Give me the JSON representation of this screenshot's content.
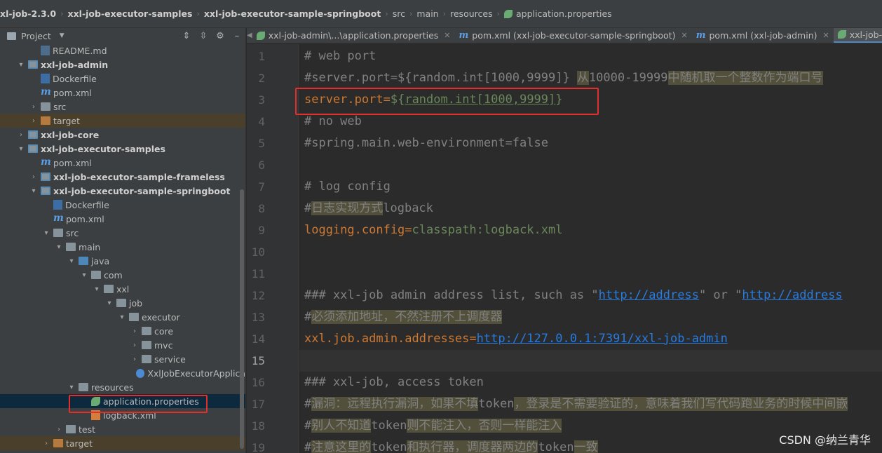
{
  "breadcrumb": [
    "xl-job-2.3.0",
    "xxl-job-executor-samples",
    "xxl-job-executor-sample-springboot",
    "src",
    "main",
    "resources",
    "application.properties"
  ],
  "project_panel": {
    "title": "Project",
    "tree": [
      {
        "label": "README.md",
        "icon": "markdown-file-icon",
        "indent": 2,
        "arrow": ""
      },
      {
        "label": "xxl-job-admin",
        "icon": "module-folder-icon",
        "indent": 1,
        "arrow": "▾",
        "bold": true
      },
      {
        "label": "Dockerfile",
        "icon": "docker-file-icon",
        "indent": 2,
        "arrow": ""
      },
      {
        "label": "pom.xml",
        "icon": "maven-file-icon",
        "indent": 2,
        "arrow": ""
      },
      {
        "label": "src",
        "icon": "folder-icon",
        "indent": 2,
        "arrow": "›"
      },
      {
        "label": "target",
        "icon": "folder-orange-icon",
        "indent": 2,
        "arrow": "›",
        "highlight": true
      },
      {
        "label": "xxl-job-core",
        "icon": "module-folder-icon",
        "indent": 1,
        "arrow": "›",
        "bold": true
      },
      {
        "label": "xxl-job-executor-samples",
        "icon": "module-folder-icon",
        "indent": 1,
        "arrow": "▾",
        "bold": true
      },
      {
        "label": "pom.xml",
        "icon": "maven-file-icon",
        "indent": 2,
        "arrow": ""
      },
      {
        "label": "xxl-job-executor-sample-frameless",
        "icon": "module-folder-icon",
        "indent": 2,
        "arrow": "›",
        "bold": true
      },
      {
        "label": "xxl-job-executor-sample-springboot",
        "icon": "module-folder-icon",
        "indent": 2,
        "arrow": "▾",
        "bold": true
      },
      {
        "label": "Dockerfile",
        "icon": "docker-file-icon",
        "indent": 3,
        "arrow": ""
      },
      {
        "label": "pom.xml",
        "icon": "maven-file-icon",
        "indent": 3,
        "arrow": ""
      },
      {
        "label": "src",
        "icon": "folder-icon",
        "indent": 3,
        "arrow": "▾"
      },
      {
        "label": "main",
        "icon": "folder-icon",
        "indent": 4,
        "arrow": "▾"
      },
      {
        "label": "java",
        "icon": "folder-blue-icon",
        "indent": 5,
        "arrow": "▾"
      },
      {
        "label": "com",
        "icon": "package-icon",
        "indent": 6,
        "arrow": "▾"
      },
      {
        "label": "xxl",
        "icon": "package-icon",
        "indent": 7,
        "arrow": "▾"
      },
      {
        "label": "job",
        "icon": "package-icon",
        "indent": 8,
        "arrow": "▾"
      },
      {
        "label": "executor",
        "icon": "package-icon",
        "indent": 9,
        "arrow": "▾"
      },
      {
        "label": "core",
        "icon": "package-icon",
        "indent": 10,
        "arrow": "›"
      },
      {
        "label": "mvc",
        "icon": "package-icon",
        "indent": 10,
        "arrow": "›"
      },
      {
        "label": "service",
        "icon": "package-icon",
        "indent": 10,
        "arrow": "›"
      },
      {
        "label": "XxlJobExecutorApplica",
        "icon": "spring-class-icon",
        "indent": 10,
        "arrow": ""
      },
      {
        "label": "resources",
        "icon": "resources-folder-icon",
        "indent": 5,
        "arrow": "▾"
      },
      {
        "label": "application.properties",
        "icon": "properties-file-icon",
        "indent": 6,
        "arrow": "",
        "selected": true
      },
      {
        "label": "logback.xml",
        "icon": "xml-file-icon",
        "indent": 6,
        "arrow": ""
      },
      {
        "label": "test",
        "icon": "folder-icon",
        "indent": 4,
        "arrow": "›"
      },
      {
        "label": "target",
        "icon": "folder-orange-icon",
        "indent": 3,
        "arrow": "›",
        "highlight": true
      }
    ]
  },
  "tabs": [
    {
      "label": "xxl-job-admin\\...\\application.properties",
      "icon": "properties-file-icon",
      "active": false
    },
    {
      "label": "pom.xml (xxl-job-executor-sample-springboot)",
      "icon": "maven-file-icon",
      "active": false
    },
    {
      "label": "pom.xml (xxl-job-admin)",
      "icon": "maven-file-icon",
      "active": false
    },
    {
      "label": "xxl-job-exec",
      "icon": "properties-file-icon",
      "active": true
    }
  ],
  "editor": {
    "current_line": 15,
    "lines": [
      {
        "n": "1",
        "text": "# web port"
      },
      {
        "n": "2",
        "text": "#server.port=${random.int[1000,9999]} 从10000-19999中随机取一个整数作为端口号"
      },
      {
        "n": "3",
        "text": "server.port=${random.int[1000,9999]}"
      },
      {
        "n": "4",
        "text": "# no web"
      },
      {
        "n": "5",
        "text": "#spring.main.web-environment=false"
      },
      {
        "n": "6",
        "text": ""
      },
      {
        "n": "7",
        "text": "# log config"
      },
      {
        "n": "8",
        "text": "#日志实现方式logback"
      },
      {
        "n": "9",
        "text": "logging.config=classpath:logback.xml"
      },
      {
        "n": "10",
        "text": ""
      },
      {
        "n": "11",
        "text": ""
      },
      {
        "n": "12",
        "text": "### xxl-job admin address list, such as \"http://address\" or \"http://address"
      },
      {
        "n": "13",
        "text": "#必须添加地址，不然注册不上调度器"
      },
      {
        "n": "14",
        "text": "xxl.job.admin.addresses=http://127.0.0.1:7391/xxl-job-admin"
      },
      {
        "n": "15",
        "text": ""
      },
      {
        "n": "16",
        "text": "### xxl-job, access token"
      },
      {
        "n": "17",
        "text": "#漏洞：远程执行漏洞，如果不填token，登录是不需要验证的，意味着我们写代码跑业务的时候中间嵌"
      },
      {
        "n": "18",
        "text": "#别人不知道token则不能注入，否则一样能注入"
      },
      {
        "n": "19",
        "text": "#注意这里的token和执行器，调度器两边的token一致"
      }
    ]
  },
  "watermark": "CSDN @纳兰青华"
}
